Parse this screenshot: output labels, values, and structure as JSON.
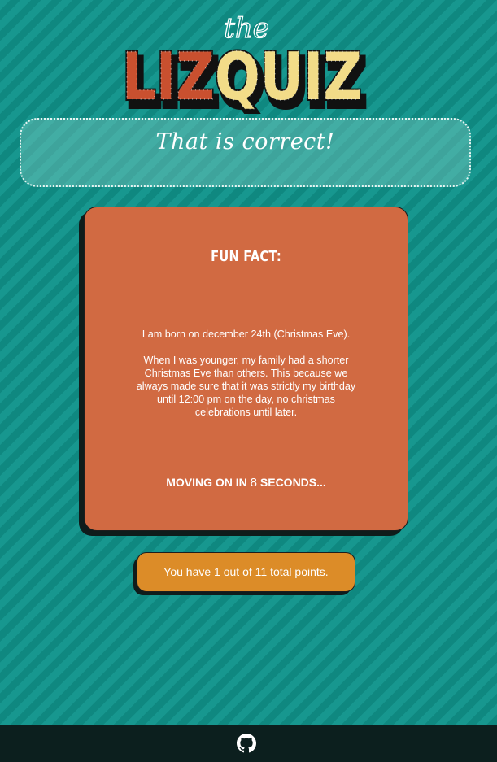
{
  "logo": {
    "small_text": "the",
    "big_text_red": "LIZ",
    "big_text_yellow": "QUIZ",
    "colors": {
      "red": "#c9502f",
      "yellow": "#f2dc88",
      "outline": "#111111"
    }
  },
  "feedback": {
    "message": "That is correct!"
  },
  "card": {
    "title": "FUN FACT:",
    "paragraphs": [
      "I am born on december 24th (Christmas Eve).",
      "When I was younger, my family had a shorter Christmas Eve than others. This because we always made sure that it was strictly my birthday until 12:00 pm on the day, no christmas celebrations until later."
    ],
    "countdown_prefix": "MOVING ON IN",
    "countdown_seconds": "8",
    "countdown_suffix": "SECONDS..."
  },
  "score": {
    "text": "You have 1 out of 11 total points."
  },
  "footer": {
    "icon": "github-icon"
  }
}
